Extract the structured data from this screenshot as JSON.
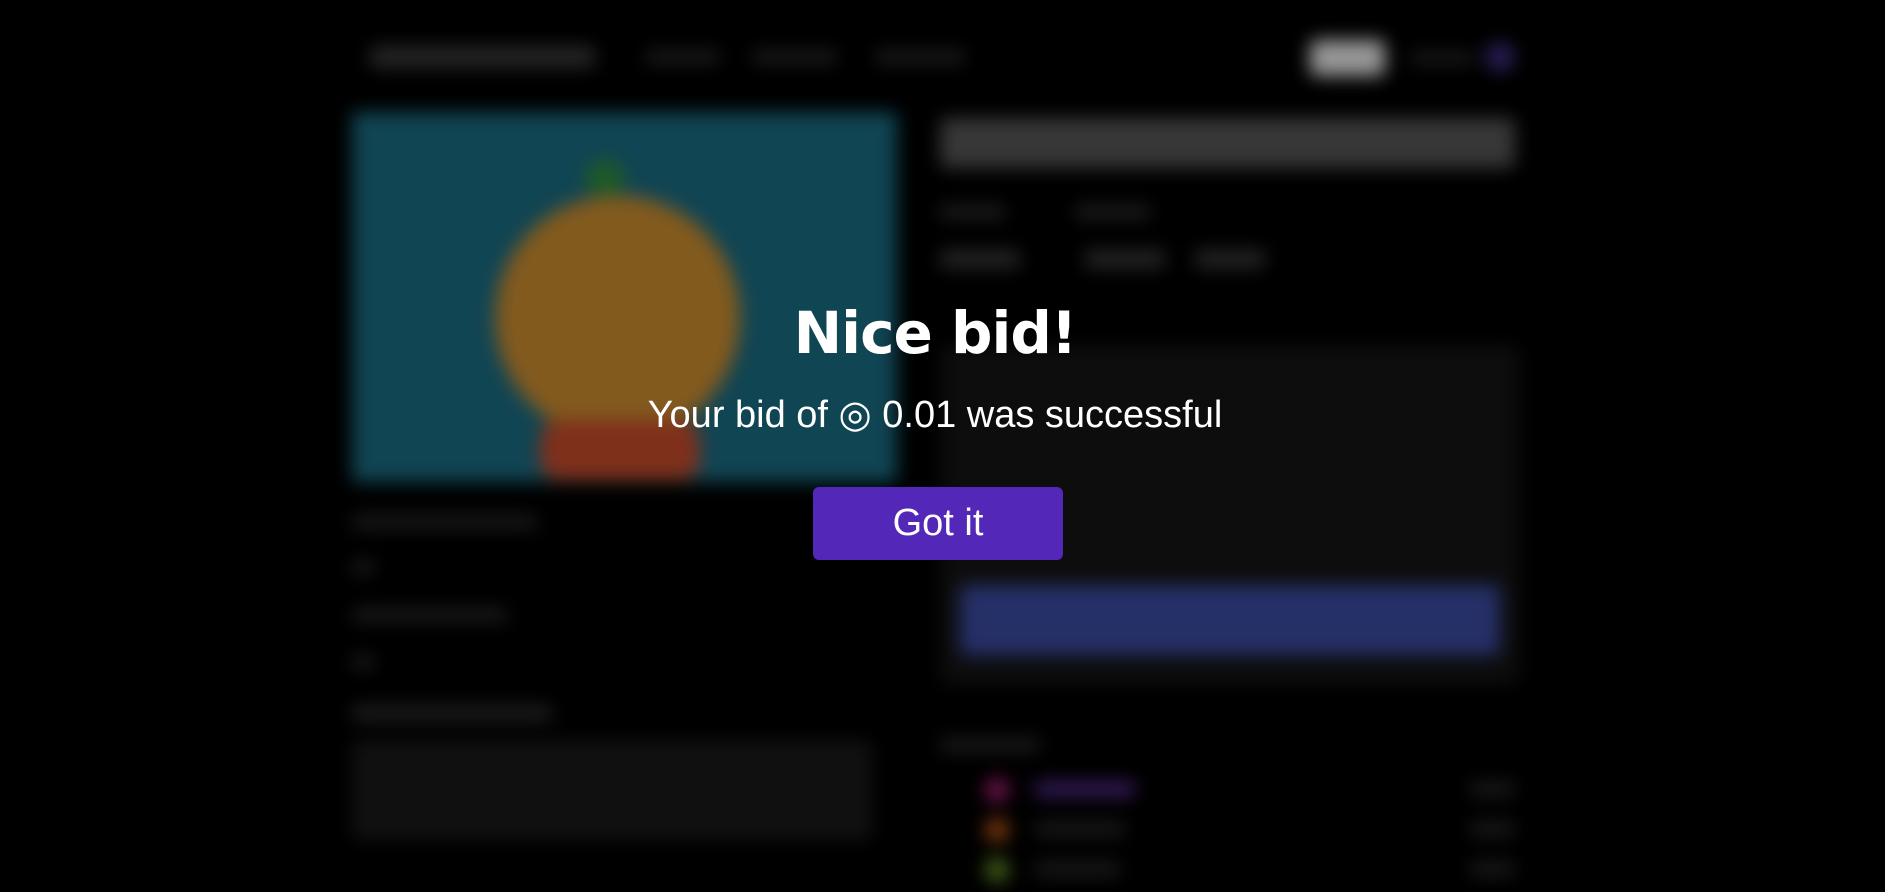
{
  "modal": {
    "title": "Nice bid!",
    "message": "Your bid of ◎ 0.01 was successful",
    "confirm_label": "Got it",
    "accent_color": "#5327b8"
  }
}
